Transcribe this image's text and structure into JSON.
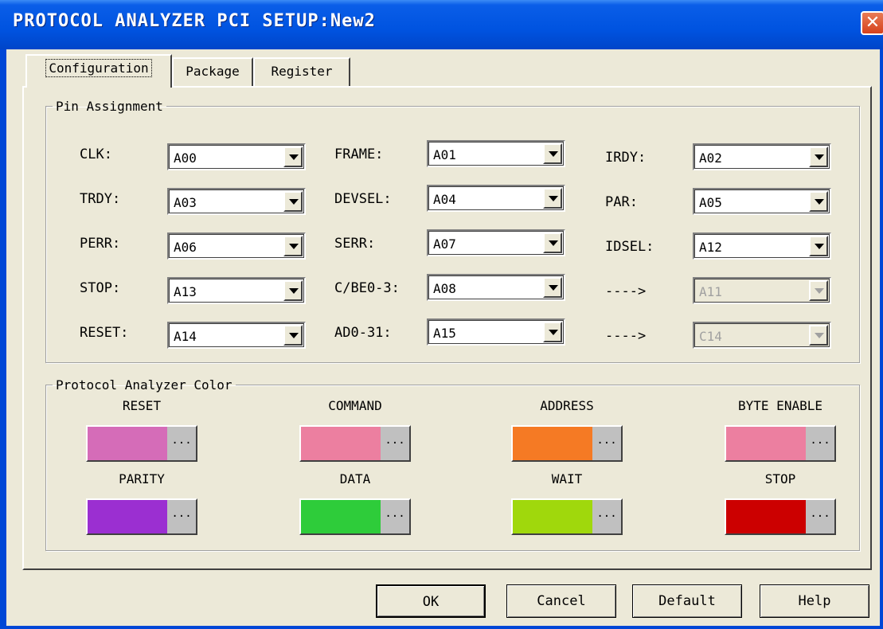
{
  "window": {
    "title": "PROTOCOL ANALYZER PCI SETUP:New2",
    "close_glyph": "✕"
  },
  "tabs": [
    {
      "label": "Configuration",
      "active": true
    },
    {
      "label": "Package",
      "active": false
    },
    {
      "label": "Register",
      "active": false
    }
  ],
  "pin_group": {
    "title": "Pin Assignment",
    "rows": [
      [
        {
          "label": "CLK:",
          "value": "A00"
        },
        {
          "label": "FRAME:",
          "value": "A01"
        },
        {
          "label": "IRDY:",
          "value": "A02"
        }
      ],
      [
        {
          "label": "TRDY:",
          "value": "A03"
        },
        {
          "label": "DEVSEL:",
          "value": "A04"
        },
        {
          "label": "PAR:",
          "value": "A05"
        }
      ],
      [
        {
          "label": "PERR:",
          "value": "A06"
        },
        {
          "label": "SERR:",
          "value": "A07"
        },
        {
          "label": "IDSEL:",
          "value": "A12"
        }
      ],
      [
        {
          "label": "STOP:",
          "value": "A13"
        },
        {
          "label": "C/BE0-3:",
          "value": "A08"
        },
        {
          "label": "---->",
          "value": "A11",
          "disabled": true
        }
      ],
      [
        {
          "label": "RESET:",
          "value": "A14"
        },
        {
          "label": "AD0-31:",
          "value": "A15"
        },
        {
          "label": "---->",
          "value": "C14",
          "disabled": true
        }
      ]
    ]
  },
  "color_group": {
    "title": "Protocol Analyzer Color",
    "more_glyph": "...",
    "items": [
      {
        "label": "RESET",
        "color": "#d56cb8"
      },
      {
        "label": "COMMAND",
        "color": "#ec7fa0"
      },
      {
        "label": "ADDRESS",
        "color": "#f57a24"
      },
      {
        "label": "BYTE ENABLE",
        "color": "#ec7fa0"
      },
      {
        "label": "PARITY",
        "color": "#9b2fd1"
      },
      {
        "label": "DATA",
        "color": "#2ecc3a"
      },
      {
        "label": "WAIT",
        "color": "#a0d80c"
      },
      {
        "label": "STOP",
        "color": "#cc0000"
      }
    ]
  },
  "buttons": {
    "ok": "OK",
    "cancel": "Cancel",
    "default": "Default",
    "help": "Help"
  }
}
